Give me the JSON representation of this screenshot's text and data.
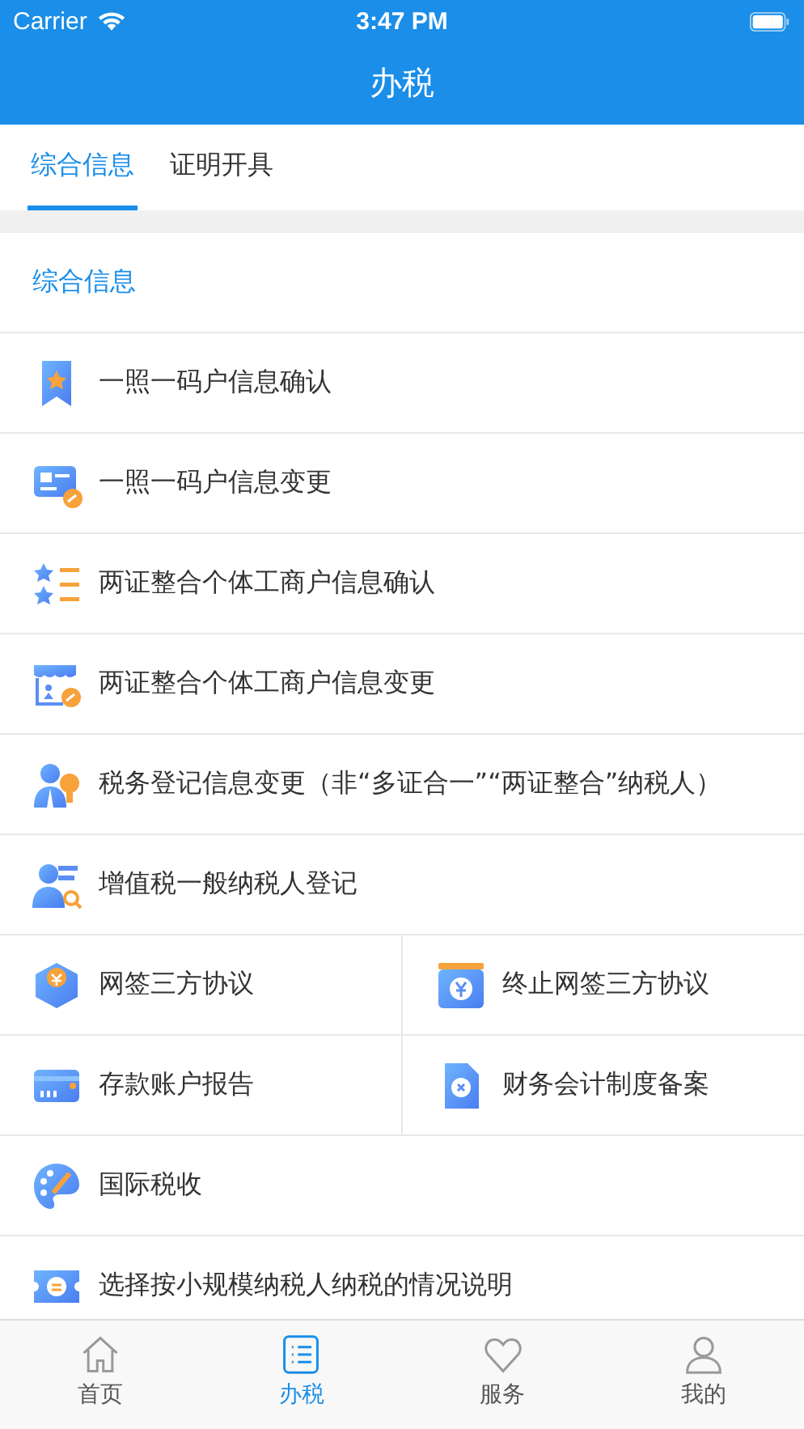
{
  "status_bar": {
    "carrier": "Carrier",
    "time": "3:47 PM"
  },
  "nav": {
    "title": "办税"
  },
  "tabs": [
    {
      "label": "综合信息",
      "selected": true
    },
    {
      "label": "证明开具",
      "selected": false
    }
  ],
  "section": {
    "title": "综合信息"
  },
  "rows": [
    {
      "kind": "single",
      "label": "一照一码户信息确认"
    },
    {
      "kind": "single",
      "label": "一照一码户信息变更"
    },
    {
      "kind": "single",
      "label": "两证整合个体工商户信息确认"
    },
    {
      "kind": "single",
      "label": "两证整合个体工商户信息变更"
    },
    {
      "kind": "single",
      "label": "税务登记信息变更（非“多证合一”“两证整合”纳税人）"
    },
    {
      "kind": "single",
      "label": "增值税一般纳税人登记"
    },
    {
      "kind": "pair",
      "items": [
        "网签三方协议",
        "终止网签三方协议"
      ]
    },
    {
      "kind": "pair",
      "items": [
        "存款账户报告",
        "财务会计制度备案"
      ]
    },
    {
      "kind": "single",
      "label": "国际税收"
    },
    {
      "kind": "single",
      "label": "选择按小规模纳税人纳税的情况说明"
    }
  ],
  "tab_bar": [
    {
      "label": "首页",
      "selected": false
    },
    {
      "label": "办税",
      "selected": true
    },
    {
      "label": "服务",
      "selected": false
    },
    {
      "label": "我的",
      "selected": false
    }
  ]
}
